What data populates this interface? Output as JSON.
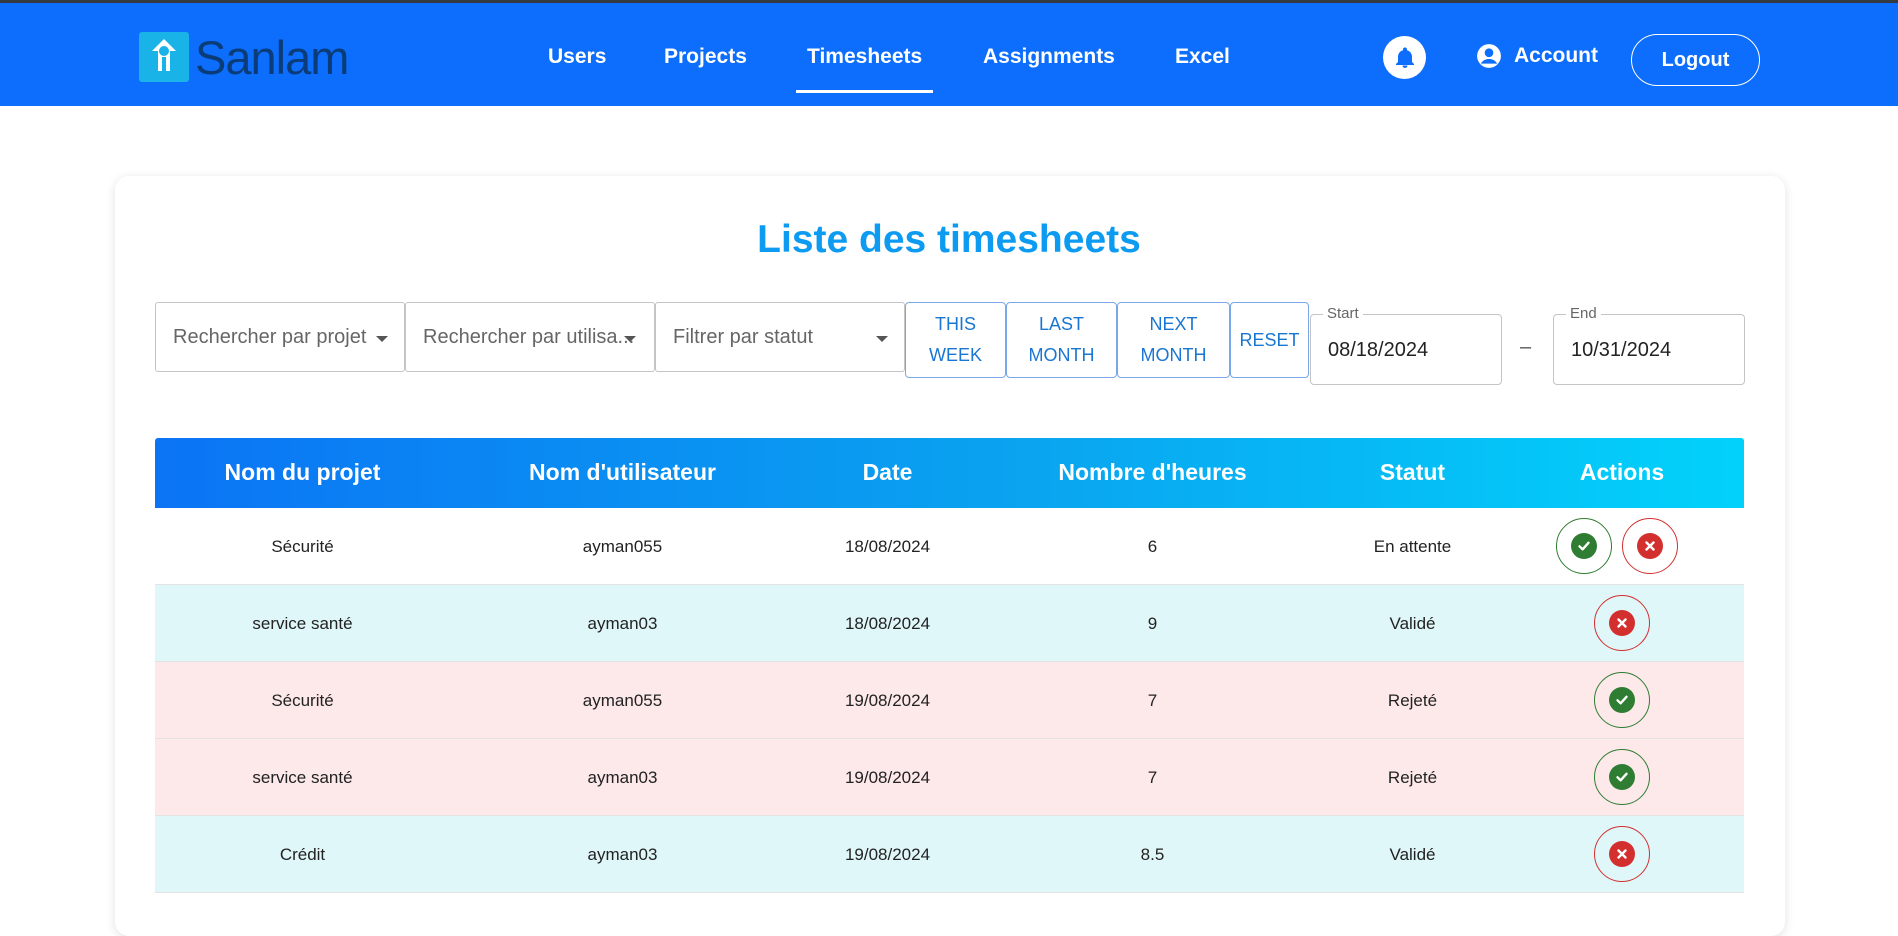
{
  "nav": {
    "brand": "Sanlam",
    "items": [
      {
        "label": "Users"
      },
      {
        "label": "Projects"
      },
      {
        "label": "Timesheets"
      },
      {
        "label": "Assignments"
      },
      {
        "label": "Excel"
      }
    ],
    "active": "Timesheets",
    "account_label": "Account",
    "logout_label": "Logout"
  },
  "page": {
    "title": "Liste des timesheets"
  },
  "filters": {
    "project_placeholder": "Rechercher par projet",
    "user_placeholder": "Rechercher par utilisa...",
    "status_placeholder": "Filtrer par statut",
    "this_week": [
      "THIS",
      "WEEK"
    ],
    "last_month": [
      "LAST",
      "MONTH"
    ],
    "next_month": [
      "NEXT",
      "MONTH"
    ],
    "reset": "RESET",
    "start_label": "Start",
    "start_value": "08/18/2024",
    "end_label": "End",
    "end_value": "10/31/2024",
    "range_separator": "–"
  },
  "table": {
    "headers": [
      "Nom du projet",
      "Nom d'utilisateur",
      "Date",
      "Nombre d'heures",
      "Statut",
      "Actions"
    ],
    "rows": [
      {
        "project": "Sécurité",
        "user": "ayman055",
        "date": "18/08/2024",
        "hours": "6",
        "status": "En attente",
        "actions": [
          "validate",
          "reject"
        ],
        "row_color": "#ffffff"
      },
      {
        "project": "service santé",
        "user": "ayman03",
        "date": "18/08/2024",
        "hours": "9",
        "status": "Validé",
        "actions": [
          "reject"
        ],
        "row_color": "#e0f7f9"
      },
      {
        "project": "Sécurité",
        "user": "ayman055",
        "date": "19/08/2024",
        "hours": "7",
        "status": "Rejeté",
        "actions": [
          "validate"
        ],
        "row_color": "#fde8ea"
      },
      {
        "project": "service santé",
        "user": "ayman03",
        "date": "19/08/2024",
        "hours": "7",
        "status": "Rejeté",
        "actions": [
          "validate"
        ],
        "row_color": "#fde8ea"
      },
      {
        "project": "Crédit",
        "user": "ayman03",
        "date": "19/08/2024",
        "hours": "8.5",
        "status": "Validé",
        "actions": [
          "reject"
        ],
        "row_color": "#e0f7f9"
      }
    ]
  },
  "colors": {
    "navbar": "#0d6efd",
    "title": "#0d9bf2",
    "validate": "#2e7d32",
    "reject": "#d32f2f",
    "pending_row": "#ffffff",
    "validated_row": "#e0f7f9",
    "rejected_row": "#fde8ea"
  }
}
